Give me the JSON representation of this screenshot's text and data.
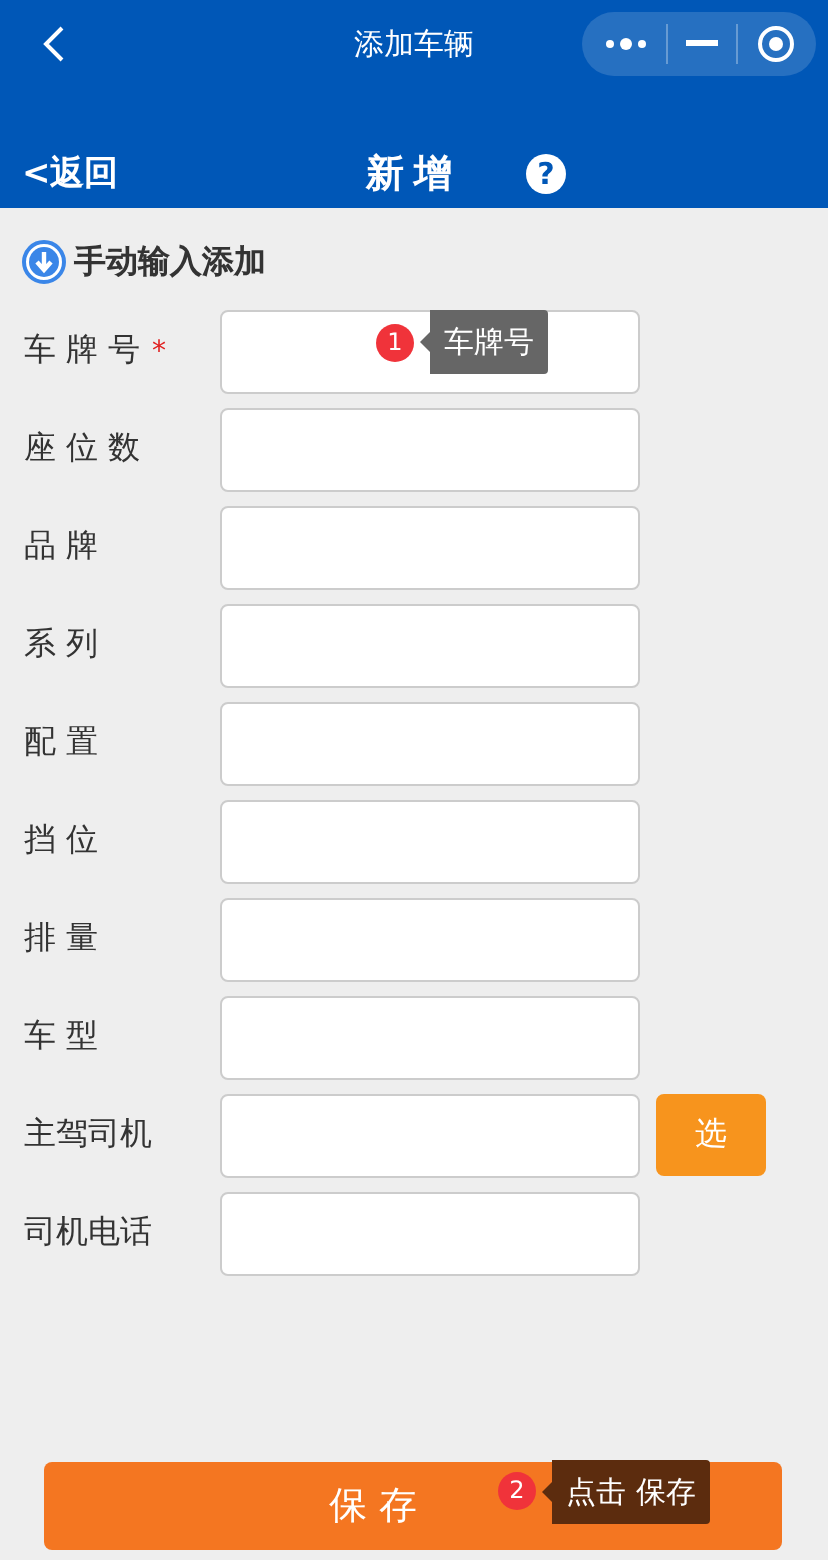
{
  "window": {
    "title": "添加车辆"
  },
  "nav": {
    "back": "<返回",
    "title": "新增",
    "help": "?"
  },
  "section": {
    "title": "手动输入添加"
  },
  "required_mark": "*",
  "fields": [
    {
      "label": "车牌号",
      "required": true,
      "kind": "text",
      "hint": {
        "number": "1",
        "text": "车牌号"
      }
    },
    {
      "label": "座位数",
      "required": false,
      "kind": "text"
    },
    {
      "label": "品牌",
      "required": false,
      "kind": "text"
    },
    {
      "label": "系列",
      "required": false,
      "kind": "text"
    },
    {
      "label": "配置",
      "required": false,
      "kind": "text"
    },
    {
      "label": "挡位",
      "required": false,
      "kind": "text"
    },
    {
      "label": "排量",
      "required": false,
      "kind": "text"
    },
    {
      "label": "车型",
      "required": false,
      "kind": "text"
    },
    {
      "label": "主驾司机",
      "required": false,
      "kind": "picker",
      "button": "选"
    },
    {
      "label": "司机电话",
      "required": false,
      "kind": "text"
    }
  ],
  "save": {
    "label": "保存",
    "hint": {
      "number": "2",
      "text": "点击 保存"
    }
  }
}
